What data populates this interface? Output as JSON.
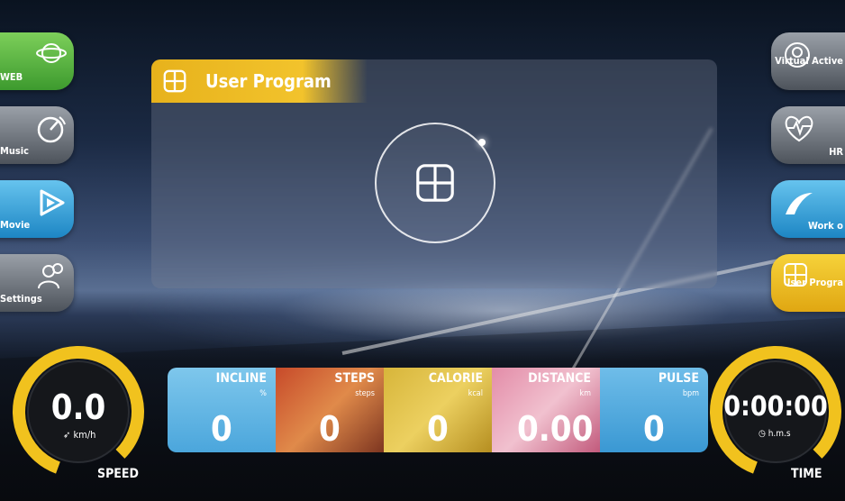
{
  "sidebar_left": [
    {
      "label": "WEB",
      "icon": "globe-icon"
    },
    {
      "label": "Music",
      "icon": "music-disc-icon"
    },
    {
      "label": "Movie",
      "icon": "film-play-icon"
    },
    {
      "label": "Settings",
      "icon": "user-settings-icon"
    }
  ],
  "sidebar_right": [
    {
      "label": "Virtual Active",
      "icon": "vr-globe-icon"
    },
    {
      "label": "HR",
      "icon": "heart-rate-icon"
    },
    {
      "label": "Work o",
      "icon": "workout-icon"
    },
    {
      "label": "User Progra",
      "icon": "user-program-icon"
    }
  ],
  "panel": {
    "title": "User Program"
  },
  "speed": {
    "value": "0.0",
    "unit": "km/h",
    "label": "SPEED"
  },
  "time": {
    "value": "0:00:00",
    "unit": "h.m.s",
    "label": "TIME"
  },
  "metrics": [
    {
      "title": "INCLINE",
      "unit": "%",
      "value": "0"
    },
    {
      "title": "STEPS",
      "unit": "steps",
      "value": "0"
    },
    {
      "title": "CALORIE",
      "unit": "kcal",
      "value": "0"
    },
    {
      "title": "DISTANCE",
      "unit": "km",
      "value": "0.00"
    },
    {
      "title": "PULSE",
      "unit": "bpm",
      "value": "0"
    }
  ]
}
